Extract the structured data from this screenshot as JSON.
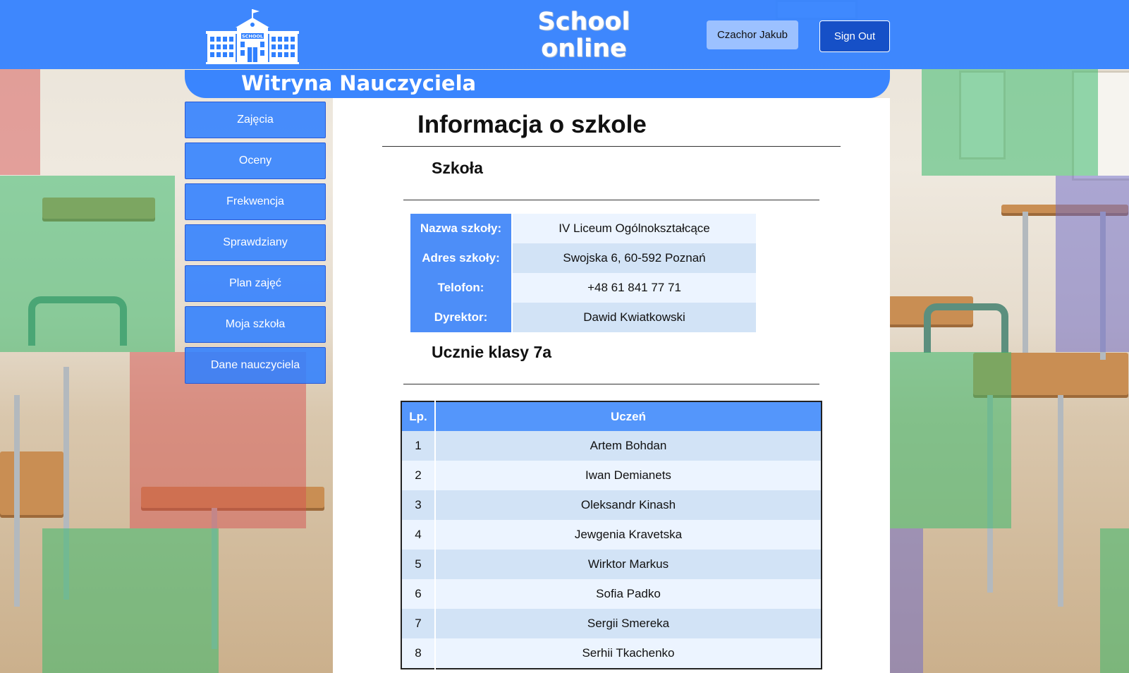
{
  "header": {
    "site_title_line1": "School",
    "site_title_line2": "online",
    "user_button": "Czachor Jakub",
    "signout_button": "Sign Out",
    "logo_text": "SCHOOL"
  },
  "subheader": {
    "title": "Witryna Nauczyciela"
  },
  "sidebar": {
    "items": [
      {
        "label": "Zajęcia"
      },
      {
        "label": "Oceny"
      },
      {
        "label": "Frekwencja"
      },
      {
        "label": "Sprawdziany"
      },
      {
        "label": "Plan zajęć"
      },
      {
        "label": "Moja szkoła"
      },
      {
        "label": "Dane nauczyciela"
      }
    ]
  },
  "main": {
    "page_title": "Informacja o szkole",
    "school_section_title": "Szkoła",
    "school_info": [
      {
        "key": "Nazwa szkoły:",
        "value": "IV Liceum Ogólnokształcące"
      },
      {
        "key": "Adres szkoły:",
        "value": "Swojska 6, 60-592 Poznań"
      },
      {
        "key": "Telofon:",
        "value": "+48 61 841 77 71"
      },
      {
        "key": "Dyrektor:",
        "value": "Dawid Kwiatkowski"
      }
    ],
    "students_section_title": "Ucznie klasy 7a",
    "students_table": {
      "headers": {
        "lp": "Lp.",
        "name": "Uczeń"
      },
      "rows": [
        {
          "lp": "1",
          "name": "Artem Bohdan"
        },
        {
          "lp": "2",
          "name": "Iwan Demianets"
        },
        {
          "lp": "3",
          "name": "Oleksandr Kinash"
        },
        {
          "lp": "4",
          "name": "Jewgenia Kravetska"
        },
        {
          "lp": "5",
          "name": "Wirktor Markus"
        },
        {
          "lp": "6",
          "name": "Sofia Padko"
        },
        {
          "lp": "7",
          "name": "Sergii Smereka"
        },
        {
          "lp": "8",
          "name": "Serhii Tkachenko"
        }
      ]
    }
  },
  "colors": {
    "header_blue": "#3080ff",
    "sidebar_blue": "#3080ff",
    "signout_blue": "#1650c7",
    "user_button_blue": "#9cc1ff",
    "table_key_blue": "#4d8ef8"
  },
  "icons": {
    "logo": "school-building-icon"
  }
}
